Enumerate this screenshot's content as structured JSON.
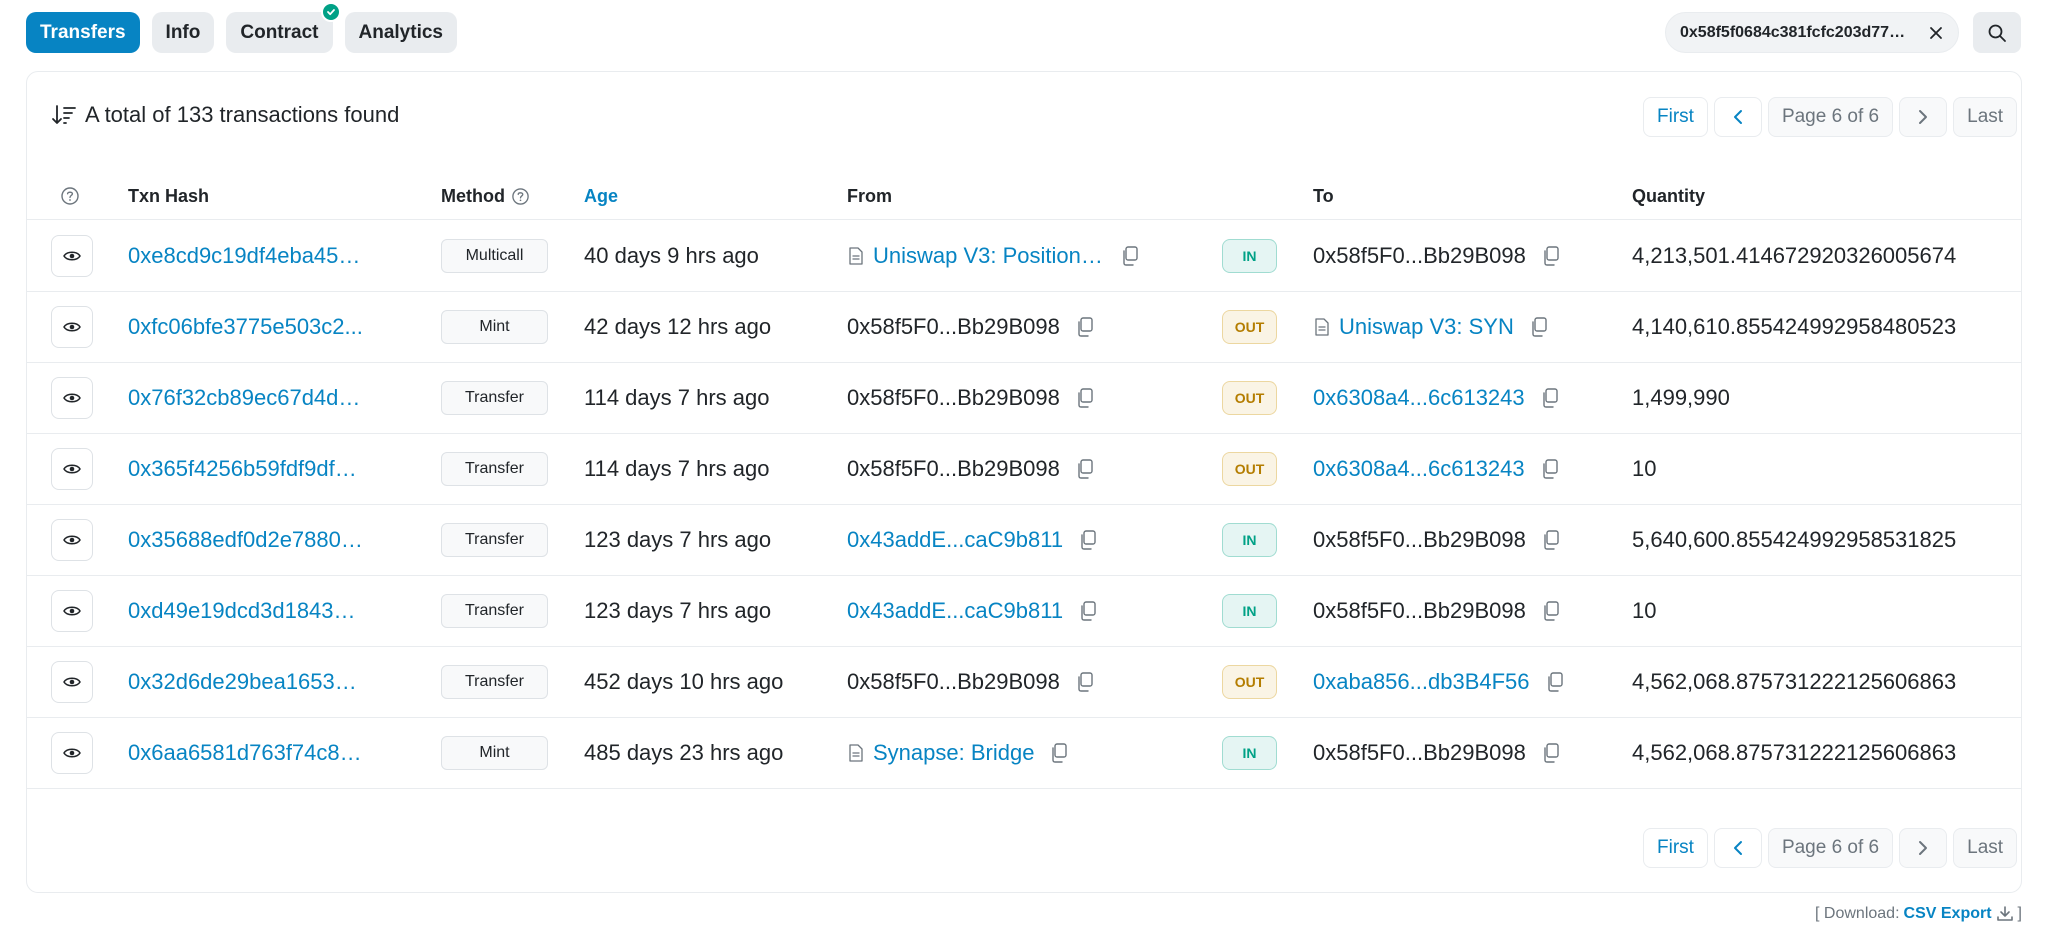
{
  "tabs": [
    {
      "label": "Transfers",
      "active": true
    },
    {
      "label": "Info",
      "active": false
    },
    {
      "label": "Contract",
      "active": false,
      "verified": true
    },
    {
      "label": "Analytics",
      "active": false
    }
  ],
  "search": {
    "value": "0x58f5f0684c381fcfc203d77b..."
  },
  "summary": {
    "text": "A total of 133 transactions found"
  },
  "pager": {
    "first": "First",
    "page": "Page 6 of 6",
    "last": "Last"
  },
  "columns": {
    "txn_hash": "Txn Hash",
    "method": "Method",
    "age": "Age",
    "from": "From",
    "to": "To",
    "quantity": "Quantity"
  },
  "rows": [
    {
      "hash": "0xe8cd9c19df4eba452...",
      "method": "Multicall",
      "age": "40 days 9 hrs ago",
      "from": "Uniswap V3: Positions ...",
      "from_link": true,
      "from_contract": true,
      "dir": "IN",
      "to": "0x58f5F0...Bb29B098",
      "to_link": false,
      "to_contract": false,
      "quantity": "4,213,501.414672920326005674"
    },
    {
      "hash": "0xfc06bfe3775e503c2...",
      "method": "Mint",
      "age": "42 days 12 hrs ago",
      "from": "0x58f5F0...Bb29B098",
      "from_link": false,
      "from_contract": false,
      "dir": "OUT",
      "to": "Uniswap V3: SYN",
      "to_link": true,
      "to_contract": true,
      "quantity": "4,140,610.855424992958480523"
    },
    {
      "hash": "0x76f32cb89ec67d4d1...",
      "method": "Transfer",
      "age": "114 days 7 hrs ago",
      "from": "0x58f5F0...Bb29B098",
      "from_link": false,
      "from_contract": false,
      "dir": "OUT",
      "to": "0x6308a4...6c613243",
      "to_link": true,
      "to_contract": false,
      "quantity": "1,499,990"
    },
    {
      "hash": "0x365f4256b59fdf9df7...",
      "method": "Transfer",
      "age": "114 days 7 hrs ago",
      "from": "0x58f5F0...Bb29B098",
      "from_link": false,
      "from_contract": false,
      "dir": "OUT",
      "to": "0x6308a4...6c613243",
      "to_link": true,
      "to_contract": false,
      "quantity": "10"
    },
    {
      "hash": "0x35688edf0d2e78809...",
      "method": "Transfer",
      "age": "123 days 7 hrs ago",
      "from": "0x43addE...caC9b811",
      "from_link": true,
      "from_contract": false,
      "dir": "IN",
      "to": "0x58f5F0...Bb29B098",
      "to_link": false,
      "to_contract": false,
      "quantity": "5,640,600.855424992958531825"
    },
    {
      "hash": "0xd49e19dcd3d1843e...",
      "method": "Transfer",
      "age": "123 days 7 hrs ago",
      "from": "0x43addE...caC9b811",
      "from_link": true,
      "from_contract": false,
      "dir": "IN",
      "to": "0x58f5F0...Bb29B098",
      "to_link": false,
      "to_contract": false,
      "quantity": "10"
    },
    {
      "hash": "0x32d6de29bea16530...",
      "method": "Transfer",
      "age": "452 days 10 hrs ago",
      "from": "0x58f5F0...Bb29B098",
      "from_link": false,
      "from_contract": false,
      "dir": "OUT",
      "to": "0xaba856...db3B4F56",
      "to_link": true,
      "to_contract": false,
      "quantity": "4,562,068.875731222125606863"
    },
    {
      "hash": "0x6aa6581d763f74c87...",
      "method": "Mint",
      "age": "485 days 23 hrs ago",
      "from": "Synapse: Bridge",
      "from_link": true,
      "from_contract": true,
      "dir": "IN",
      "to": "0x58f5F0...Bb29B098",
      "to_link": false,
      "to_contract": false,
      "quantity": "4,562,068.875731222125606863"
    }
  ],
  "download": {
    "prefix": "[ Download:",
    "link": "CSV Export",
    "suffix": "]"
  },
  "colors": {
    "accent": "#0784c3",
    "in": "#00a186",
    "out": "#b47d00",
    "border": "#e9ecef"
  }
}
